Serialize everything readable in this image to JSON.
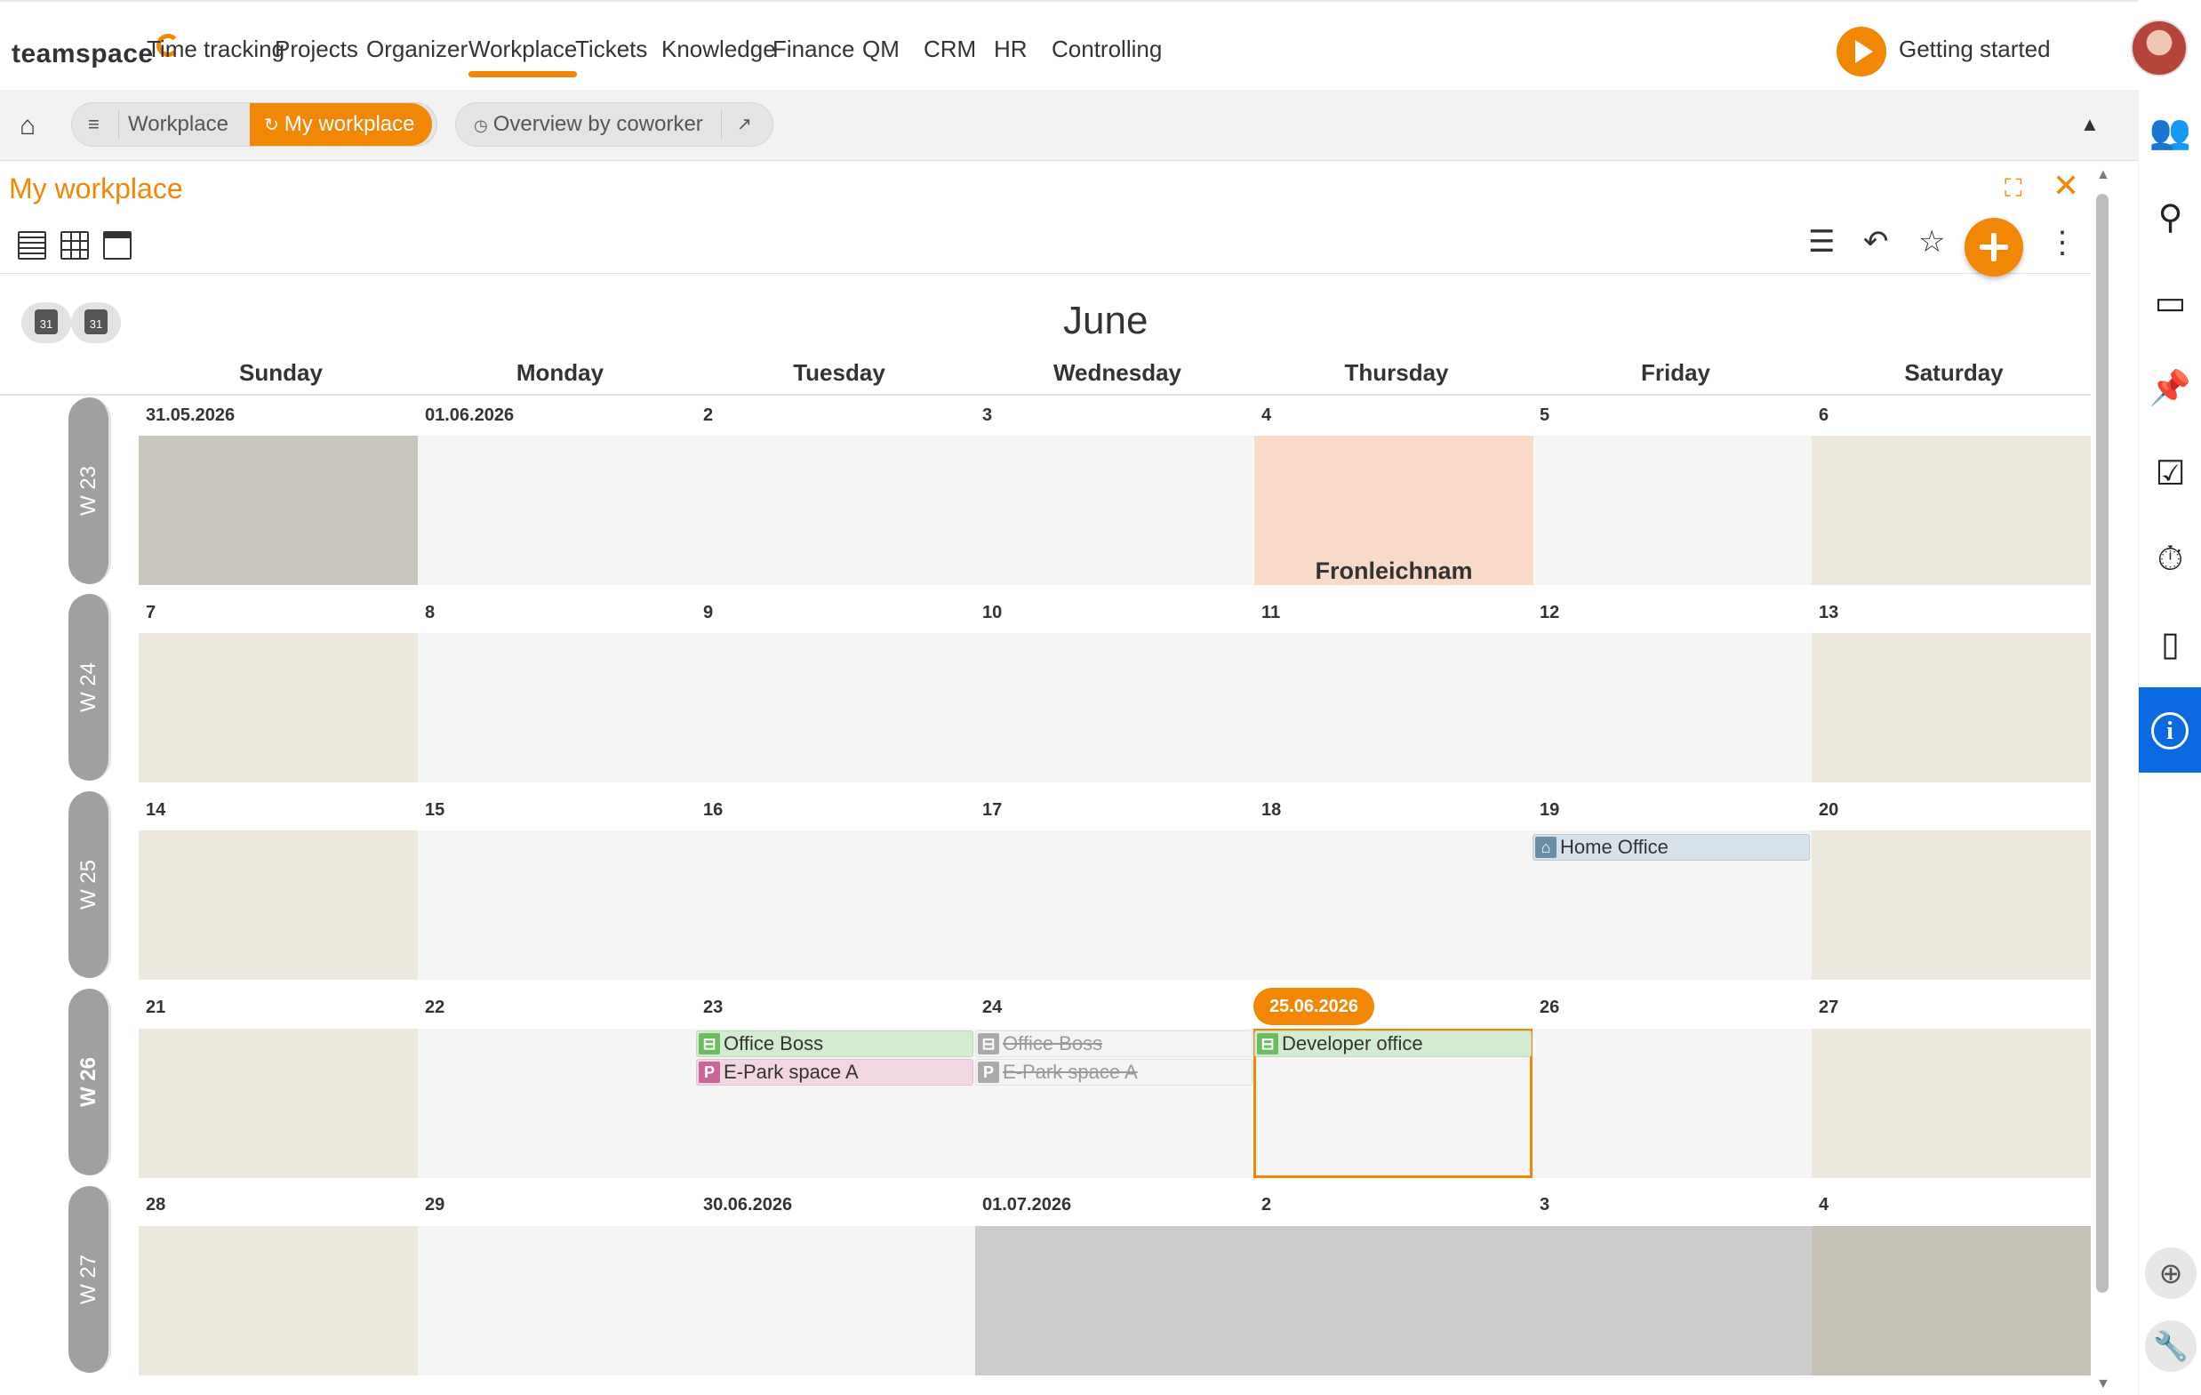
{
  "nav": {
    "logo": "teamspace",
    "items": [
      "Time tracking",
      "Projects",
      "Organizer",
      "Workplace",
      "Tickets",
      "Knowledge",
      "Finance",
      "QM",
      "CRM",
      "HR",
      "Controlling"
    ],
    "active": "Workplace",
    "getting_started": "Getting started"
  },
  "breadcrumb": {
    "menu_icon": "≡",
    "workplace": "Workplace",
    "my_workplace": "My workplace",
    "overview": "Overview by coworker"
  },
  "panel": {
    "title": "My workplace"
  },
  "calendar": {
    "month": "June",
    "weekdays": [
      "Sunday",
      "Monday",
      "Tuesday",
      "Wednesday",
      "Thursday",
      "Friday",
      "Saturday"
    ],
    "weeks": [
      {
        "label": "W 23",
        "days": [
          "31.05.2026",
          "01.06.2026",
          "2",
          "3",
          "4",
          "5",
          "6"
        ]
      },
      {
        "label": "W 24",
        "days": [
          "7",
          "8",
          "9",
          "10",
          "11",
          "12",
          "13"
        ]
      },
      {
        "label": "W 25",
        "days": [
          "14",
          "15",
          "16",
          "17",
          "18",
          "19",
          "20"
        ]
      },
      {
        "label": "W 26",
        "days": [
          "21",
          "22",
          "23",
          "24",
          "25.06.2026",
          "26",
          "27"
        ]
      },
      {
        "label": "W 27",
        "days": [
          "28",
          "29",
          "30.06.2026",
          "01.07.2026",
          "2",
          "3",
          "4"
        ]
      }
    ],
    "holiday": "Fronleichnam",
    "today": "25.06.2026",
    "events": {
      "home_office": "Home Office",
      "office_boss": "Office Boss",
      "park_a": "E-Park space A",
      "office_boss_cancelled": "Office Boss",
      "park_a_cancelled": "E-Park space A",
      "developer_office": "Developer office"
    },
    "icon_letters": {
      "park": "P"
    }
  },
  "colors": {
    "accent": "#f28705",
    "info": "#0a6adf",
    "weekend": "#ece8dd",
    "holiday": "#f9dac8",
    "office_event": "#d3ecd1",
    "parking_event": "#f2d6e2",
    "home_event": "#d7e1e9"
  },
  "icons": {
    "home": "home-icon",
    "external": "external-link-icon",
    "filter": "filter-icon",
    "undo": "undo-icon",
    "star": "star-icon",
    "add": "add-icon",
    "more": "more-vertical-icon",
    "sidebar": [
      "people-icon",
      "search-icon",
      "wallet-icon",
      "pin-icon",
      "tasks-icon",
      "timer-icon",
      "mobile-icon",
      "info-icon",
      "plus-circle-icon",
      "wrench-icon"
    ]
  }
}
